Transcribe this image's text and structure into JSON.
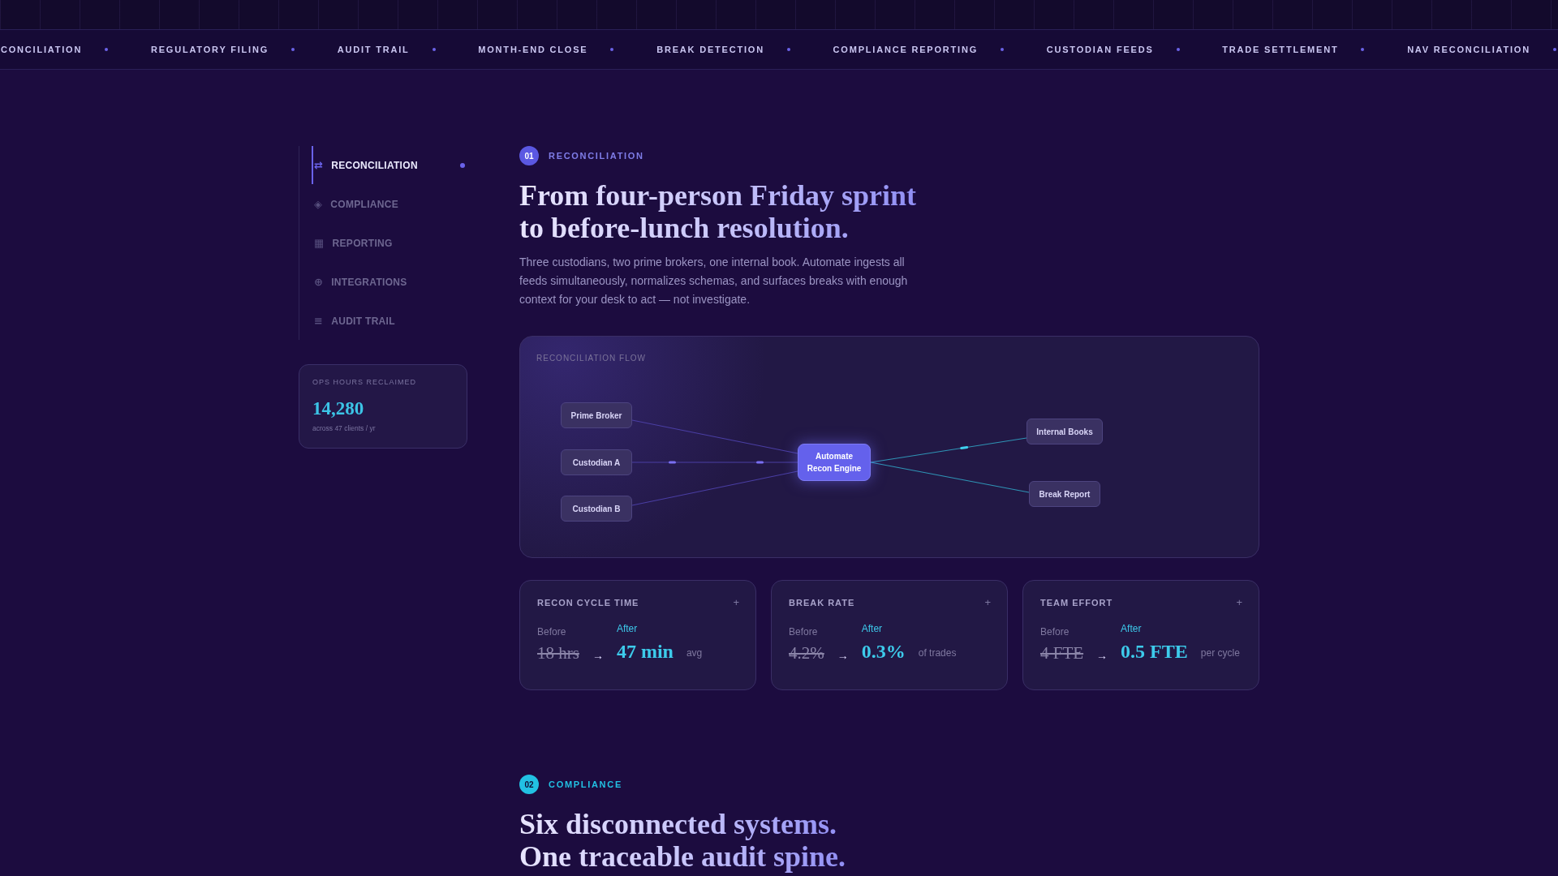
{
  "ticker": {
    "items": [
      "CONCILIATION",
      "REGULATORY FILING",
      "AUDIT TRAIL",
      "MONTH-END CLOSE",
      "BREAK DETECTION",
      "COMPLIANCE REPORTING",
      "CUSTODIAN FEEDS",
      "TRADE SETTLEMENT",
      "NAV RECONCILIATION"
    ]
  },
  "sidebar": {
    "items": [
      {
        "icon": "⇄",
        "label": "RECONCILIATION",
        "selected": true
      },
      {
        "icon": "◈",
        "label": "COMPLIANCE",
        "selected": false
      },
      {
        "icon": "▦",
        "label": "REPORTING",
        "selected": false
      },
      {
        "icon": "⊕",
        "label": "INTEGRATIONS",
        "selected": false
      },
      {
        "icon": "≡",
        "label": "AUDIT TRAIL",
        "selected": false
      }
    ],
    "stat_card": {
      "label": "OPS HOURS RECLAIMED",
      "value": "14,280",
      "caption": "across 47 clients / yr"
    }
  },
  "sections": [
    {
      "number": "01",
      "label": "RECONCILIATION",
      "color": "#5b58e2",
      "heading_lines": [
        "From four-person Friday sprint",
        "to before-lunch resolution."
      ],
      "body": "Three custodians, two prime brokers, one internal book. Automate ingests all feeds simultaneously, normalizes schemas, and surfaces breaks with enough context for your desk to act — not investigate.",
      "flow": {
        "title": "RECONCILIATION FLOW",
        "sources": [
          "Prime Broker",
          "Custodian A",
          "Custodian B"
        ],
        "engine": "Automate Recon Engine",
        "outputs": [
          "Internal Books",
          "Break Report"
        ]
      },
      "metrics": [
        {
          "title": "RECON CYCLE TIME",
          "toggle": "+",
          "before_label": "Before",
          "before": "18 hrs",
          "arrow": "→",
          "after_label": "After",
          "after": "47 min",
          "unit": "avg"
        },
        {
          "title": "BREAK RATE",
          "toggle": "+",
          "before_label": "Before",
          "before": "4.2%",
          "arrow": "→",
          "after_label": "After",
          "after": "0.3%",
          "unit": "of trades"
        },
        {
          "title": "TEAM EFFORT",
          "toggle": "+",
          "before_label": "Before",
          "before": "4 FTE",
          "arrow": "→",
          "after_label": "After",
          "after": "0.5 FTE",
          "unit": "per cycle"
        }
      ]
    },
    {
      "number": "02",
      "label": "COMPLIANCE",
      "color": "#22c1e3",
      "heading_lines": [
        "Six disconnected systems.",
        "One traceable audit spine."
      ]
    }
  ]
}
